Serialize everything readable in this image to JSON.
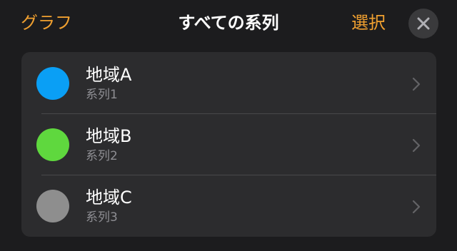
{
  "nav": {
    "back_label": "グラフ",
    "title": "すべての系列",
    "select_label": "選択",
    "close_icon": "close-icon"
  },
  "series_list": [
    {
      "name": "地域A",
      "subtitle": "系列1",
      "color": "#0a9ff5"
    },
    {
      "name": "地域B",
      "subtitle": "系列2",
      "color": "#5fd83e"
    },
    {
      "name": "地域C",
      "subtitle": "系列3",
      "color": "#8e8e8e"
    }
  ],
  "colors": {
    "accent": "#f0a030",
    "background": "#1c1c1e",
    "list_background": "#2c2c2e"
  }
}
